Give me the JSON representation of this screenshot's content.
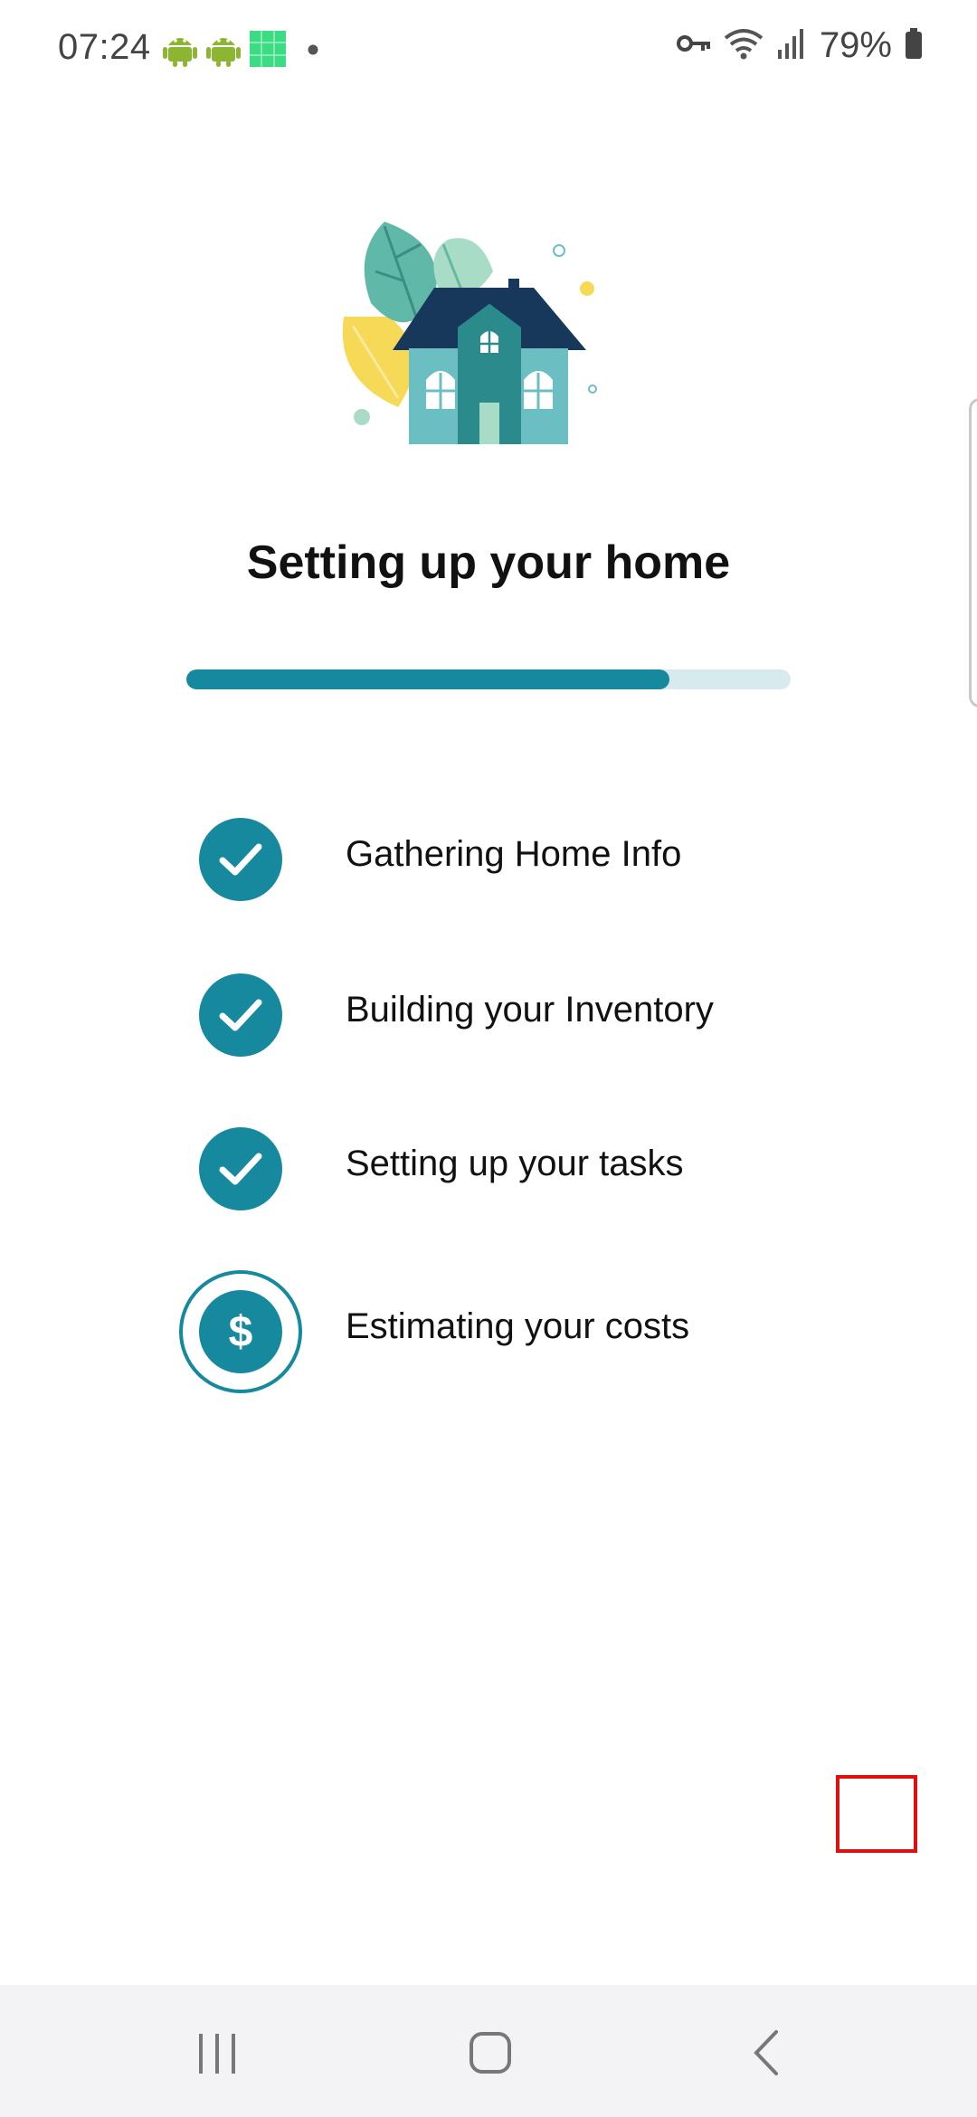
{
  "status_bar": {
    "time": "07:24",
    "battery_percent": "79%",
    "left_icons": [
      "android-icon",
      "android-icon",
      "app-grid-icon",
      "dot-icon"
    ],
    "right_icons": [
      "vpn-key-icon",
      "wifi-icon",
      "signal-icon",
      "battery-icon"
    ]
  },
  "screen": {
    "title": "Setting up your home",
    "progress": 0.8
  },
  "steps": [
    {
      "label": "Gathering Home Info",
      "state": "done",
      "icon": "check-icon"
    },
    {
      "label": "Building your Inventory",
      "state": "done",
      "icon": "check-icon"
    },
    {
      "label": "Setting up your tasks",
      "state": "done",
      "icon": "check-icon"
    },
    {
      "label": "Estimating your costs",
      "state": "in-progress",
      "icon": "dollar-icon",
      "icon_text": "$"
    }
  ],
  "nav_bar": {
    "buttons": [
      "recent-apps-icon",
      "home-icon",
      "back-icon"
    ]
  },
  "colors": {
    "accent": "#17899f",
    "progress_track": "#d7eaee",
    "house_roof": "#17385a",
    "house_wall": "#6bbfc2",
    "house_door": "#2a8a8c",
    "leaf_green": "#5fb8a8",
    "leaf_light": "#a9dcc6",
    "leaf_yellow": "#f5d957",
    "marker": "#e01010"
  }
}
